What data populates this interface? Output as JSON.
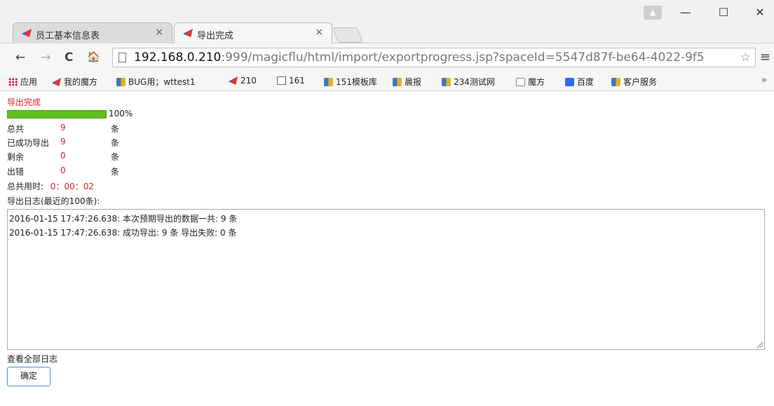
{
  "browser": {
    "tabs": [
      {
        "label": "员工基本信息表",
        "active": false
      },
      {
        "label": "导出完成",
        "active": true
      }
    ],
    "close_glyph": "×",
    "url_host": "192.168.0.210",
    "url_rest": ":999/magicflu/html/import/exportprogress.jsp?spaceId=5547d87f-be64-4022-9f5",
    "window_controls": {
      "minimize": "—",
      "maximize": "☐",
      "close": "✕"
    },
    "nav": {
      "back": "←",
      "forward": "→",
      "reload": "C",
      "home": "🏠",
      "menu": "≡",
      "star": "☆"
    }
  },
  "bookmarks": [
    {
      "icon": "apps-icon",
      "label": "应用"
    },
    {
      "icon": "flag-icon",
      "label": "我的魔方"
    },
    {
      "icon": "box-icon",
      "label": "BUG用；wttest1"
    },
    {
      "icon": "flag-icon",
      "label": "210"
    },
    {
      "icon": "chart-icon",
      "label": "161"
    },
    {
      "icon": "box-icon",
      "label": "151模板库"
    },
    {
      "icon": "box-icon",
      "label": "晨报"
    },
    {
      "icon": "box-icon",
      "label": "234测试网"
    },
    {
      "icon": "folder-icon",
      "label": "魔方"
    },
    {
      "icon": "baidu-icon",
      "label": "百度"
    },
    {
      "icon": "box-icon",
      "label": "客户服务"
    }
  ],
  "bookmarks_more": "»",
  "export": {
    "status": "导出完成",
    "progress_percent": 100,
    "progress_label": "100%",
    "rows": [
      {
        "label": "总共",
        "value": "9",
        "unit": "条"
      },
      {
        "label": "已成功导出",
        "value": "9",
        "unit": "条"
      },
      {
        "label": "剩余",
        "value": "0",
        "unit": "条"
      },
      {
        "label": "出错",
        "value": "0",
        "unit": "条"
      }
    ],
    "elapsed_label": "总共用时:",
    "elapsed_value": "0：00：02",
    "log_title": "导出日志(最近的100条):",
    "log_lines": [
      "2016-01-15 17:47:26.638: 本次预期导出的数据一共: 9 条",
      "2016-01-15 17:47:26.638: 成功导出: 9 条 导出失败: 0 条"
    ],
    "view_all_log": "查看全部日志",
    "ok_button": "确定"
  },
  "colors": {
    "accent_red": "#e52222",
    "progress_green": "#5fc01c"
  }
}
